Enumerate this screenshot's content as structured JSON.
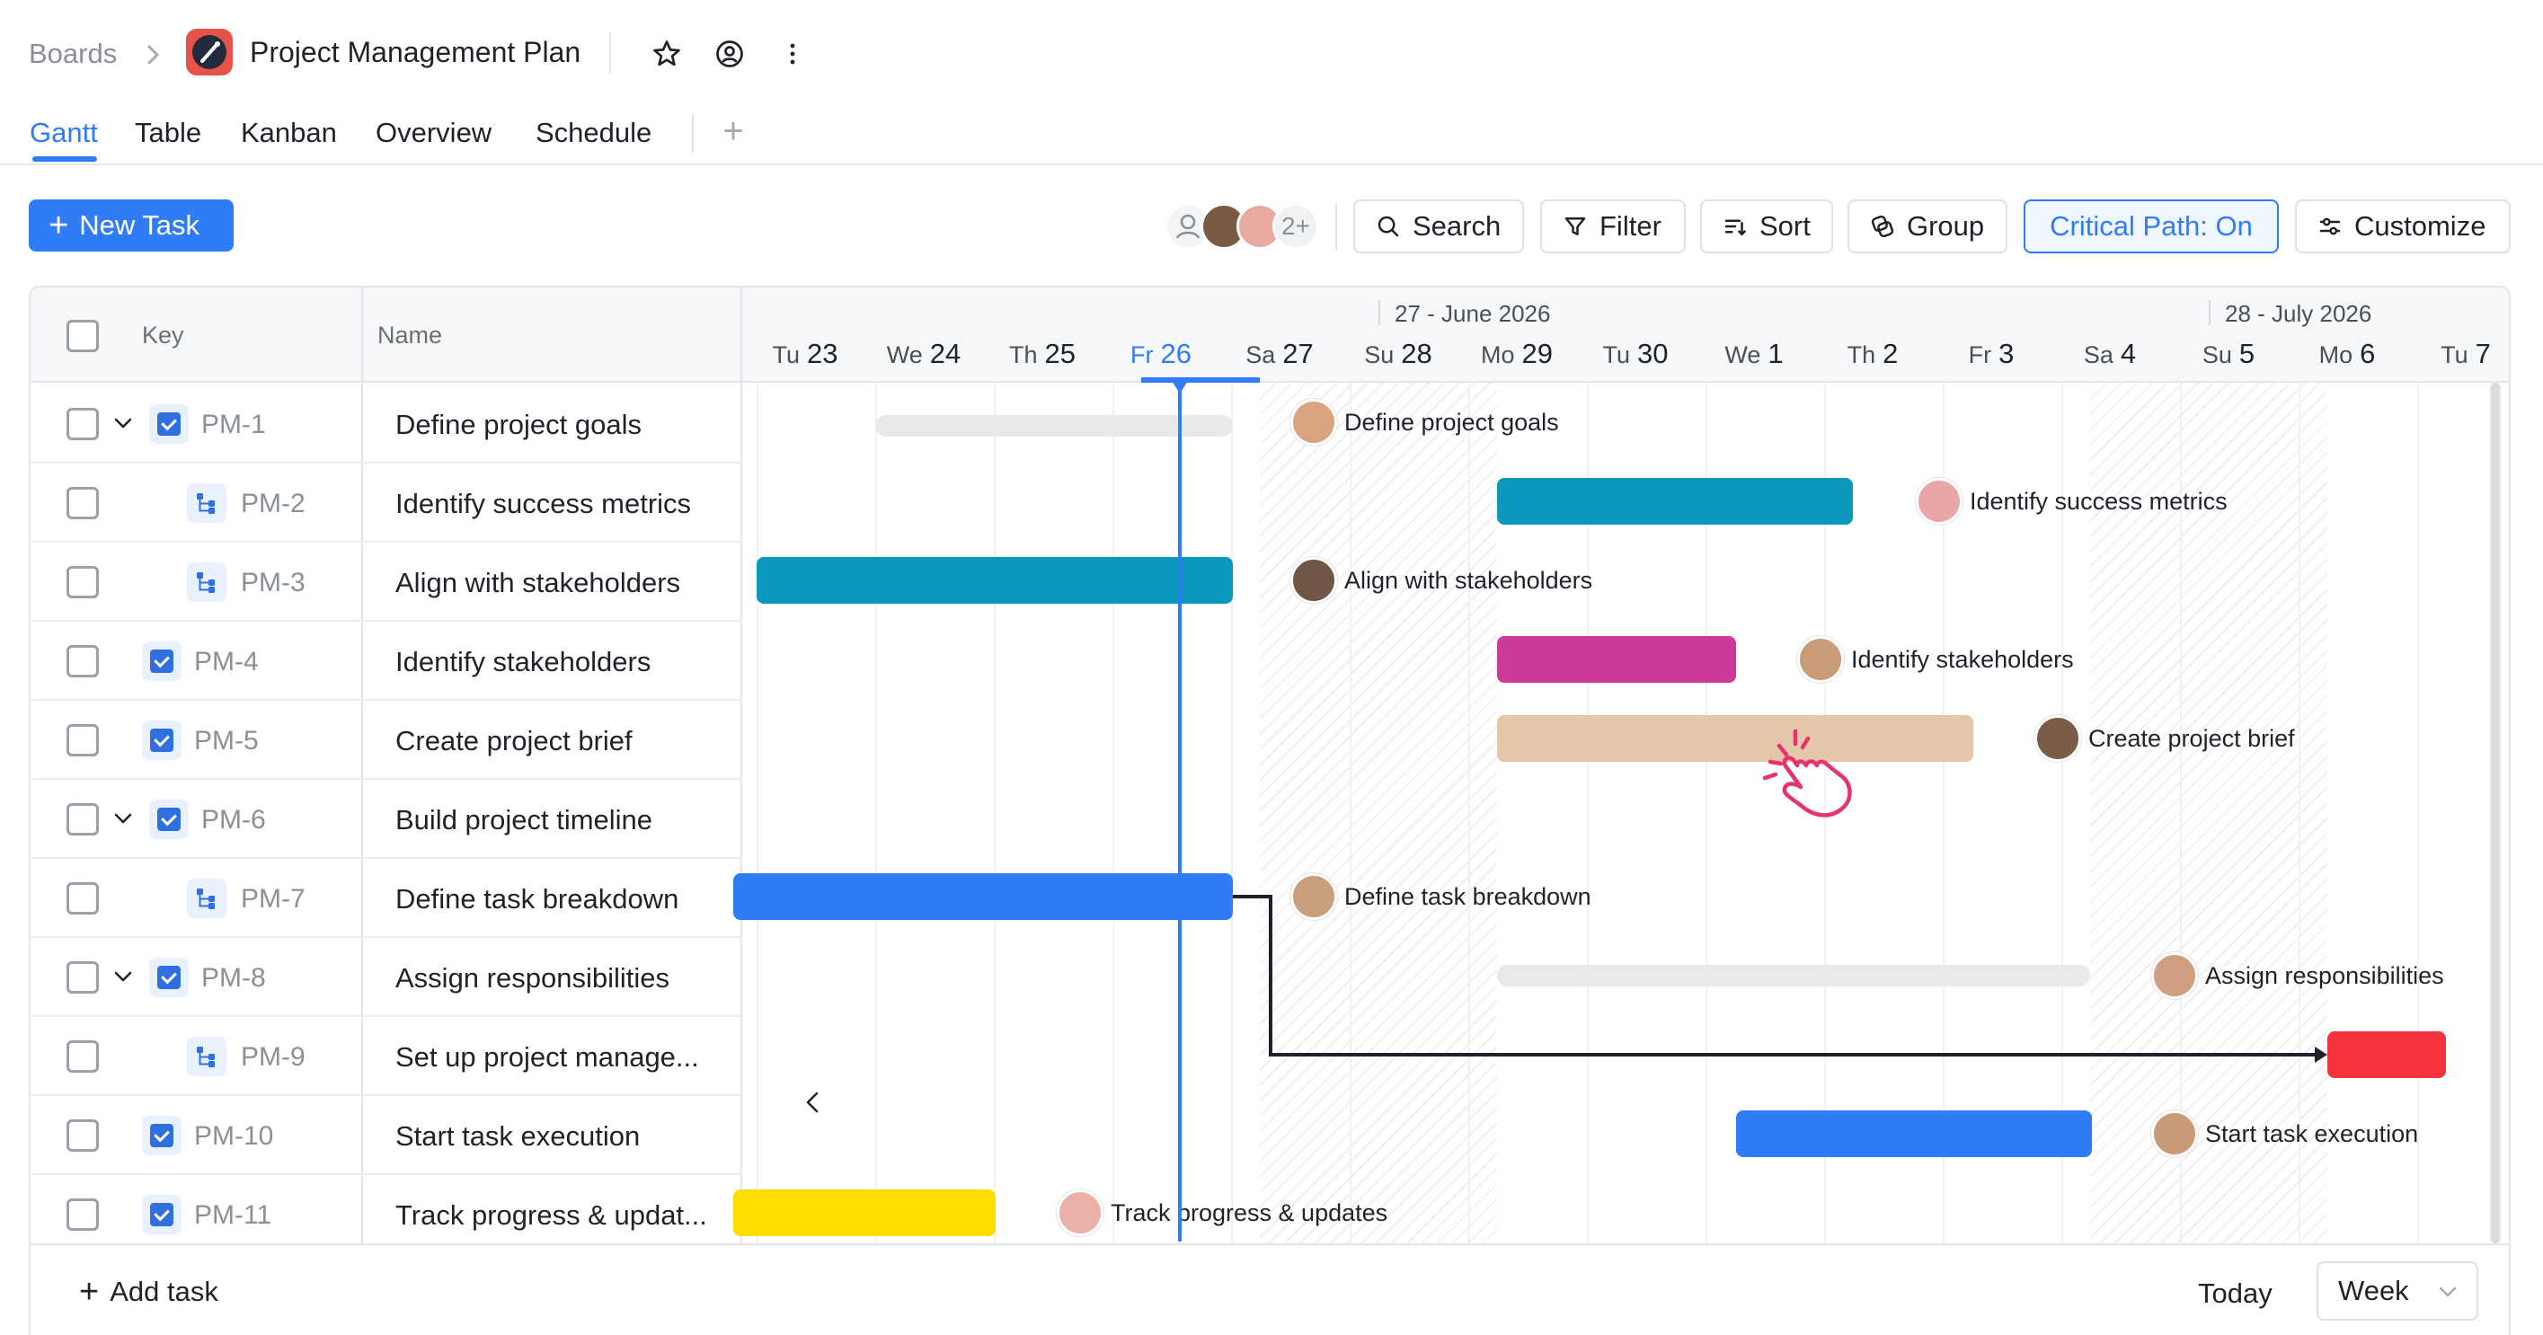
{
  "header": {
    "breadcrumb": "Boards",
    "title": "Project Management Plan"
  },
  "tabs": [
    {
      "label": "Gantt",
      "active": true
    },
    {
      "label": "Table"
    },
    {
      "label": "Kanban"
    },
    {
      "label": "Overview"
    },
    {
      "label": "Schedule"
    }
  ],
  "toolbar": {
    "new_task": "New Task",
    "avatars_more": "2+",
    "search": "Search",
    "filter": "Filter",
    "sort": "Sort",
    "group": "Group",
    "critical_path": "Critical Path: On",
    "customize": "Customize"
  },
  "columns": {
    "key": "Key",
    "name": "Name"
  },
  "tasks": [
    {
      "key": "PM-1",
      "name": "Define project goals",
      "indent": false,
      "expandable": true
    },
    {
      "key": "PM-2",
      "name": "Identify success metrics",
      "indent": true,
      "expandable": false
    },
    {
      "key": "PM-3",
      "name": "Align with stakeholders",
      "indent": true,
      "expandable": false
    },
    {
      "key": "PM-4",
      "name": "Identify stakeholders",
      "indent": false,
      "expandable": false
    },
    {
      "key": "PM-5",
      "name": "Create project brief",
      "indent": false,
      "expandable": false
    },
    {
      "key": "PM-6",
      "name": "Build project timeline",
      "indent": false,
      "expandable": true
    },
    {
      "key": "PM-7",
      "name": "Define task breakdown",
      "indent": true,
      "expandable": false
    },
    {
      "key": "PM-8",
      "name": "Assign responsibilities",
      "indent": false,
      "expandable": true
    },
    {
      "key": "PM-9",
      "name": "Set up project manage...",
      "indent": true,
      "expandable": false
    },
    {
      "key": "PM-10",
      "name": "Start task execution",
      "indent": false,
      "expandable": false
    },
    {
      "key": "PM-11",
      "name": "Track progress & updat...",
      "indent": false,
      "expandable": false
    }
  ],
  "timeline": {
    "months": [
      "27 - June 2026",
      "28 - July 2026"
    ],
    "days": [
      {
        "dow": "Tu",
        "num": "23"
      },
      {
        "dow": "We",
        "num": "24"
      },
      {
        "dow": "Th",
        "num": "25"
      },
      {
        "dow": "Fr",
        "num": "26",
        "today": true
      },
      {
        "dow": "Sa",
        "num": "27"
      },
      {
        "dow": "Su",
        "num": "28"
      },
      {
        "dow": "Mo",
        "num": "29"
      },
      {
        "dow": "Tu",
        "num": "30"
      },
      {
        "dow": "We",
        "num": "1"
      },
      {
        "dow": "Th",
        "num": "2"
      },
      {
        "dow": "Fr",
        "num": "3"
      },
      {
        "dow": "Sa",
        "num": "4"
      },
      {
        "dow": "Su",
        "num": "5"
      },
      {
        "dow": "Mo",
        "num": "6"
      },
      {
        "dow": "Tu",
        "num": "7"
      }
    ]
  },
  "bar_labels": {
    "pm1": "Define project goals",
    "pm2": "Identify success metrics",
    "pm3": "Align with stakeholders",
    "pm4": "Identify stakeholders",
    "pm5": "Create project brief",
    "pm7": "Define task breakdown",
    "pm8": "Assign responsibilities",
    "pm10": "Start task execution",
    "pm11": "Track progress & updates"
  },
  "colors": {
    "accent": "#2f7cf6",
    "teal": "#0a99bd",
    "magenta": "#cc3a9a",
    "peach": "#e6c6a8",
    "red": "#f4333e",
    "yellow": "#fedd00",
    "summary": "#e8e9eb"
  },
  "footer": {
    "add_task": "Add task",
    "today": "Today",
    "scale": "Week"
  }
}
